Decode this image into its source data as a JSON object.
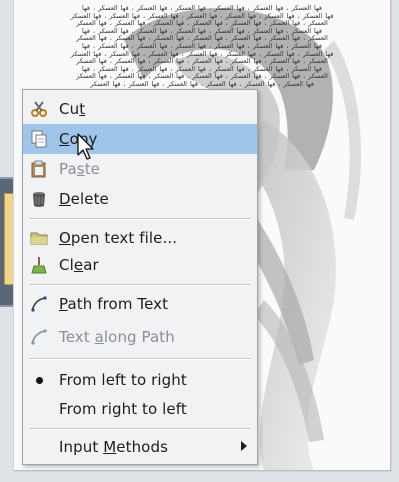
{
  "canvas": {
    "arabic_lines": [
      "فها العسكر ، فها العسكر ، فها العسكر ، فها العسكر ، فها العسكر ، فها العسكر ، فها",
      "فها العسكر ، فها العسكر ، فها العسكر ، فها العسكر ، فها العسكر ، فها العسكر ، فها العسكر",
      "العسكر ، فها العسكر ، فها العسكر ، فها العسكر ، فها العسكر ، فها العسكر ، فها العسكر",
      "فها العسكر ، فها العسكر ، فها العسكر ، فها العسكر ، فها العسكر ، فها العسكر ، فها",
      "العسكر ، فها العسكر ، فها العسكر ، فها العسكر ، فها العسكر ، فها العسكر ، فها العسكر",
      "فها العسكر ، فها العسكر ، فها العسكر ، فها العسكر ، فها العسكر ، فها العسكر ، فها",
      "فها العسكر ، فها العسكر ، فها العسكر ، فها العسكر ، فها العسكر ، فها العسكر ، فها العسكر",
      "العسكر ، فها العسكر ، فها العسكر ، فها العسكر ، فها العسكر ، فها العسكر ، فها العسكر",
      "فها العسكر ، فها العسكر ، فها العسكر ، فها العسكر ، فها العسكر ، فها العسكر ، فها",
      "العسكر ، فها العسكر ، فها العسكر ، فها العسكر ، فها العسكر ، فها العسكر ، فها العسكر",
      "فها العسكر ، فها العسكر ، فها العسكر ، فها العسكر ، فها العسكر ، فها العسكر"
    ]
  },
  "menu": {
    "cut": {
      "pre": "Cu",
      "ul": "t",
      "post": "",
      "icon": "scissors-icon"
    },
    "copy": {
      "pre": "",
      "ul": "C",
      "post": "opy",
      "icon": "copy-icon"
    },
    "paste": {
      "pre": "Pa",
      "ul": "s",
      "post": "te",
      "icon": "paste-icon"
    },
    "delete": {
      "pre": "",
      "ul": "D",
      "post": "elete",
      "icon": "trash-icon"
    },
    "open_text_file": {
      "pre": "",
      "ul": "O",
      "post": "pen text file...",
      "icon": "folder-icon"
    },
    "clear": {
      "pre": "Cl",
      "ul": "e",
      "post": "ar",
      "icon": "broom-icon"
    },
    "path_from_text": {
      "pre": "",
      "ul": "P",
      "post": "ath from Text",
      "icon": "path-icon"
    },
    "text_along_path": {
      "pre": "Text ",
      "ul": "a",
      "post": "long Path",
      "icon": "path-icon"
    },
    "ltr": {
      "label": "From left to right"
    },
    "rtl": {
      "label": "From right to left"
    },
    "input_methods": {
      "pre": "Input ",
      "ul": "M",
      "post": "ethods"
    }
  },
  "colors": {
    "selection": "#9fc6ea",
    "menu_bg": "#f1f2f4",
    "disabled_text": "#8a8f96"
  }
}
